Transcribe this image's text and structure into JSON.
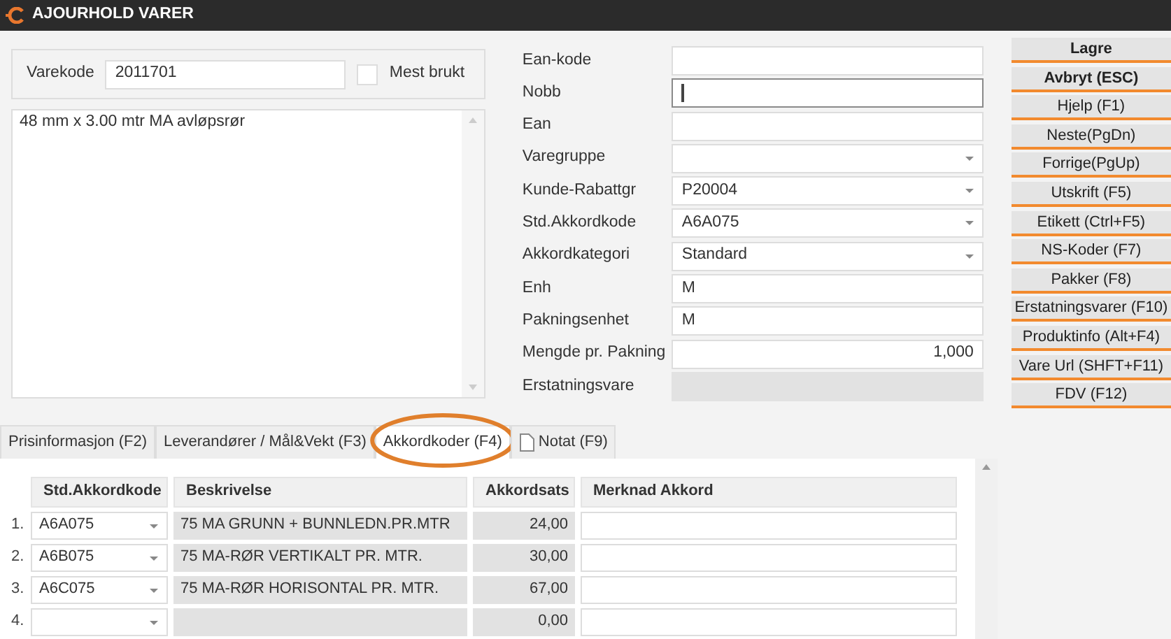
{
  "window": {
    "title": "AJOURHOLD VARER"
  },
  "item": {
    "code_label": "Varekode",
    "code": "2011701",
    "favorite_label": "Mest brukt",
    "favorite": false,
    "description": "48 mm x 3.00 mtr MA avløpsrør"
  },
  "form": [
    {
      "label": "Ean-kode",
      "kind": "text",
      "focused": false
    },
    {
      "label": "Nobb",
      "kind": "text",
      "focused": true
    },
    {
      "label": "Ean",
      "kind": "text",
      "focused": false
    },
    {
      "label": "Varegruppe",
      "kind": "combo",
      "focused": false
    },
    {
      "label": "Kunde-Rabattgr",
      "kind": "combo",
      "value": "P20004",
      "focused": false
    },
    {
      "label": "Std.Akkordkode",
      "kind": "combo",
      "value": "A6A075",
      "focused": false
    },
    {
      "label": "Akkordkategori",
      "kind": "combo",
      "value": "Standard",
      "focused": false
    },
    {
      "label": "Enh",
      "kind": "text",
      "value": "M",
      "focused": false
    },
    {
      "label": "Pakningsenhet",
      "kind": "text",
      "value": "M",
      "focused": false
    },
    {
      "label": "Mengde pr. Pakning",
      "kind": "number",
      "value": "1,000",
      "focused": false
    },
    {
      "label": "Erstatningsvare",
      "kind": "readonly",
      "focused": false
    }
  ],
  "buttons": [
    {
      "label": "Lagre",
      "kind": "primary"
    },
    {
      "label": "Avbryt (ESC)",
      "kind": "primary"
    },
    {
      "label": "Hjelp (F1)",
      "kind": "normal"
    },
    {
      "label": "Neste(PgDn)",
      "kind": "normal"
    },
    {
      "label": "Forrige(PgUp)",
      "kind": "normal"
    },
    {
      "label": "Utskrift (F5)",
      "kind": "normal"
    },
    {
      "label": "Etikett (Ctrl+F5)",
      "kind": "normal"
    },
    {
      "label": "NS-Koder (F7)",
      "kind": "normal"
    },
    {
      "label": "Pakker (F8)",
      "kind": "normal"
    },
    {
      "label": "Erstatningsvarer (F10)",
      "kind": "normal"
    },
    {
      "label": "Produktinfo (Alt+F4)",
      "kind": "normal"
    },
    {
      "label": "Vare Url (SHFT+F11)",
      "kind": "normal"
    },
    {
      "label": "FDV (F12)",
      "kind": "normal"
    }
  ],
  "tabs": [
    {
      "label": "Prisinformasjon (F2)",
      "selected": false,
      "circled": false
    },
    {
      "label": "Leverandører / Mål&Vekt (F3)",
      "selected": false,
      "circled": false
    },
    {
      "label": "Akkordkoder (F4)",
      "selected": true,
      "circled": true
    },
    {
      "label": "Notat (F9)",
      "selected": false,
      "circled": false,
      "kind": "note"
    }
  ],
  "table": {
    "columns": [
      "Std.Akkordkode",
      "Beskrivelse",
      "Akkordsats",
      "Merknad Akkord"
    ],
    "rows": [
      {
        "number": "1.",
        "code": "A6A075",
        "description": "75 MA GRUNN + BUNNLEDN.PR.MTR",
        "rate": "24,00"
      },
      {
        "number": "2.",
        "code": "A6B075",
        "description": "75 MA-RØR VERTIKALT PR. MTR.",
        "rate": "30,00"
      },
      {
        "number": "3.",
        "code": "A6C075",
        "description": "75 MA-RØR HORISONTAL PR. MTR.",
        "rate": "67,00"
      },
      {
        "number": "4.",
        "rate": "0,00"
      }
    ]
  }
}
